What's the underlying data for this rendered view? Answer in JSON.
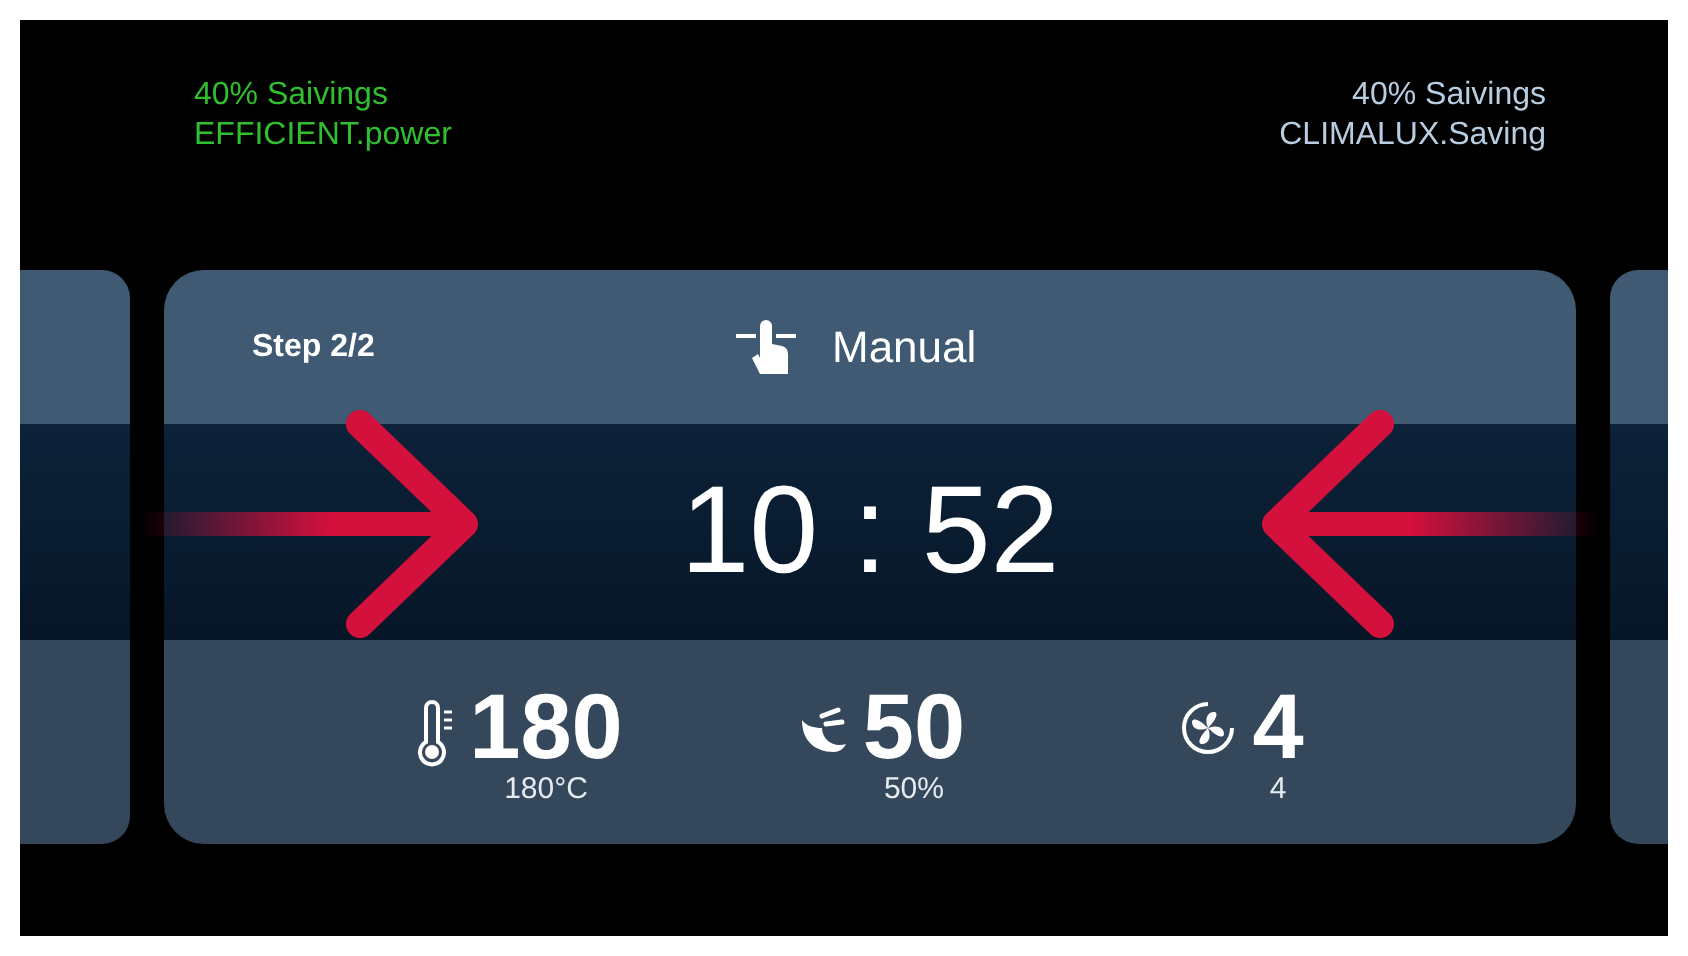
{
  "savings_left": {
    "lines": [
      "40% Saivings",
      "EFFICIENT.power"
    ]
  },
  "savings_right": {
    "lines": [
      "40% Saivings",
      "CLIMALUX.Saving"
    ]
  },
  "step_card": {
    "step": "Step 2/2",
    "mode": {
      "kind": "manual",
      "label": "Manual"
    },
    "time": "10 : 52",
    "readings": [
      {
        "kind": "temperature",
        "value": "180",
        "sub": "180°C"
      },
      {
        "kind": "steam",
        "value": "50",
        "sub": "50%"
      },
      {
        "kind": "fan",
        "value": "4",
        "sub": "4"
      }
    ]
  }
}
